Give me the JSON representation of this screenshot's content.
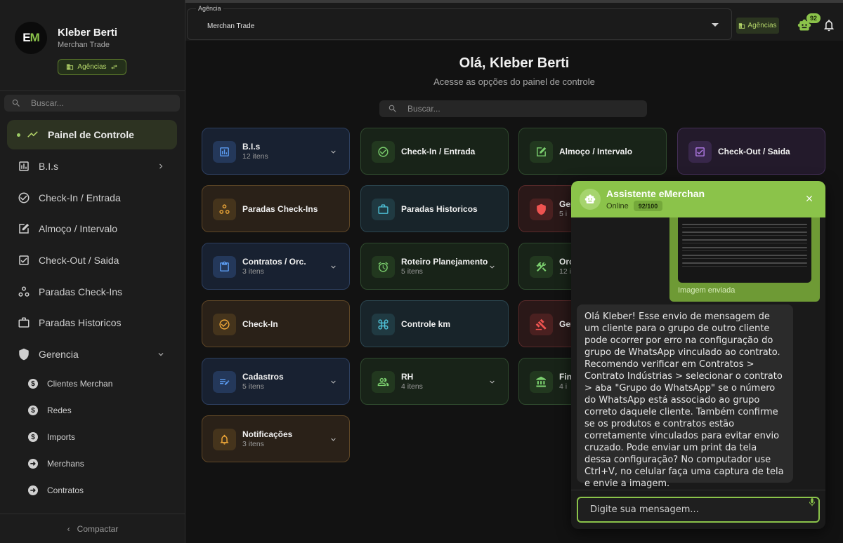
{
  "sidebar": {
    "logo_text": "EM",
    "user_name": "Kleber Berti",
    "user_company": "Merchan Trade",
    "agency_button": "Agências",
    "search_placeholder": "Buscar...",
    "active_item": "Painel de Controle",
    "items": [
      {
        "label": "B.I.s",
        "icon": "chart-icon"
      },
      {
        "label": "Check-In / Entrada",
        "icon": "check-circle-icon"
      },
      {
        "label": "Almoço / Intervalo",
        "icon": "edit-box-icon"
      },
      {
        "label": "Check-Out / Saida",
        "icon": "checkbox-icon"
      },
      {
        "label": "Paradas Check-Ins",
        "icon": "workflow-icon"
      },
      {
        "label": "Paradas Historicos",
        "icon": "briefcase-icon"
      },
      {
        "label": "Gerencia",
        "icon": "shield-icon"
      }
    ],
    "sub_items": [
      {
        "label": "Clientes Merchan",
        "icon": "dollar-icon"
      },
      {
        "label": "Redes",
        "icon": "dollar-icon"
      },
      {
        "label": "Imports",
        "icon": "dollar-icon"
      },
      {
        "label": "Merchans",
        "icon": "arrow-circle-icon"
      },
      {
        "label": "Contratos",
        "icon": "arrow-circle-icon"
      }
    ],
    "compact_label": "Compactar"
  },
  "topbar": {
    "agency_legend": "Agência",
    "agency_value": "Merchan Trade",
    "agency_button": "Agências",
    "robot_badge": "92"
  },
  "main": {
    "greeting": "Olá, Kleber Berti",
    "subtitle": "Acesse as opções do painel de controle",
    "search_placeholder": "Buscar...",
    "cards": [
      {
        "title": "B.I.s",
        "sub": "12 itens"
      },
      {
        "title": "Check-In / Entrada",
        "sub": ""
      },
      {
        "title": "Almoço / Intervalo",
        "sub": ""
      },
      {
        "title": "Check-Out / Saida",
        "sub": ""
      },
      {
        "title": "Paradas Check-Ins",
        "sub": ""
      },
      {
        "title": "Paradas Historicos",
        "sub": ""
      },
      {
        "title": "Ger",
        "sub": "5 i"
      },
      {
        "title": "Contratos / Orc.",
        "sub": "3 itens"
      },
      {
        "title": "Roteiro Planejamento",
        "sub": "5 itens"
      },
      {
        "title": "Orc",
        "sub": "12 i"
      },
      {
        "title": "Check-In",
        "sub": ""
      },
      {
        "title": "Controle km",
        "sub": ""
      },
      {
        "title": "Ger",
        "sub": ""
      },
      {
        "title": "Cadastros",
        "sub": "5 itens"
      },
      {
        "title": "RH",
        "sub": "4 itens"
      },
      {
        "title": "Fin",
        "sub": "4 i"
      },
      {
        "title": "Notificações",
        "sub": "3 itens"
      }
    ]
  },
  "chat": {
    "title": "Assistente eMerchan",
    "status": "Online",
    "count": "92/100",
    "image_caption": "Imagem enviada",
    "bot_message": "Olá Kleber! Esse envio de mensagem de um cliente para o grupo de outro cliente pode ocorrer por erro na configuração do grupo de WhatsApp vinculado ao contrato. Recomendo verificar em Contratos > Contrato Indústrias > selecionar o contrato > aba \"Grupo do WhatsApp\" se o número do WhatsApp está associado ao grupo correto daquele cliente. Também confirme se os produtos e contratos estão corretamente vinculados para evitar envio cruzado. Pode enviar um print da tela dessa configuração? No computador use Ctrl+V, no celular faça uma captura de tela e envie a imagem.",
    "input_placeholder": "Digite sua mensagem..."
  }
}
